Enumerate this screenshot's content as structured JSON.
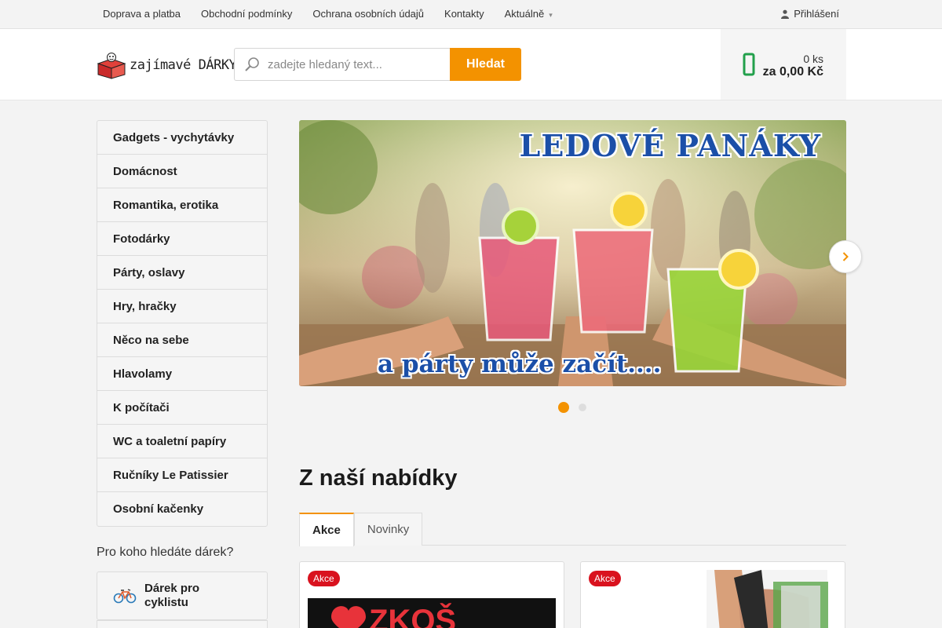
{
  "topnav": {
    "items": [
      {
        "label": "Doprava a platba"
      },
      {
        "label": "Obchodní podmínky"
      },
      {
        "label": "Ochrana osobních údajů"
      },
      {
        "label": "Kontakty"
      },
      {
        "label": "Aktuálně"
      }
    ],
    "login_label": "Přihlášení"
  },
  "header": {
    "logo_text": "zajímavé DÁRKY",
    "search_placeholder": "zadejte hledaný text...",
    "search_button": "Hledat",
    "cart_count": "0 ks",
    "cart_total": "za 0,00 Kč"
  },
  "sidebar": {
    "categories": [
      {
        "label": "Gadgets - vychytávky"
      },
      {
        "label": "Domácnost"
      },
      {
        "label": "Romantika, erotika"
      },
      {
        "label": "Fotodárky"
      },
      {
        "label": "Párty, oslavy"
      },
      {
        "label": "Hry, hračky"
      },
      {
        "label": "Něco na sebe"
      },
      {
        "label": "Hlavolamy"
      },
      {
        "label": "K počítači"
      },
      {
        "label": "WC a toaletní papíry"
      },
      {
        "label": "Ručníky Le Patissier"
      },
      {
        "label": "Osobní kačenky"
      }
    ],
    "for_whom_heading": "Pro koho hledáte dárek?",
    "personas": [
      {
        "label": "Dárek pro cyklistu",
        "icon": "bicycle-icon"
      }
    ]
  },
  "banner": {
    "title": "LEDOVÉ PANÁKY",
    "subtitle": "a párty může začít....",
    "slide_index": 1,
    "slide_count": 2
  },
  "offer": {
    "heading": "Z naší nabídky",
    "tabs": [
      {
        "label": "Akce",
        "active": true
      },
      {
        "label": "Novinky",
        "active": false
      }
    ],
    "products": [
      {
        "badge": "Akce"
      },
      {
        "badge": "Akce"
      }
    ]
  },
  "colors": {
    "accent": "#f39200",
    "cart_icon": "#22a04b",
    "badge": "#d9121e",
    "banner_text": "#1b4fa8"
  }
}
